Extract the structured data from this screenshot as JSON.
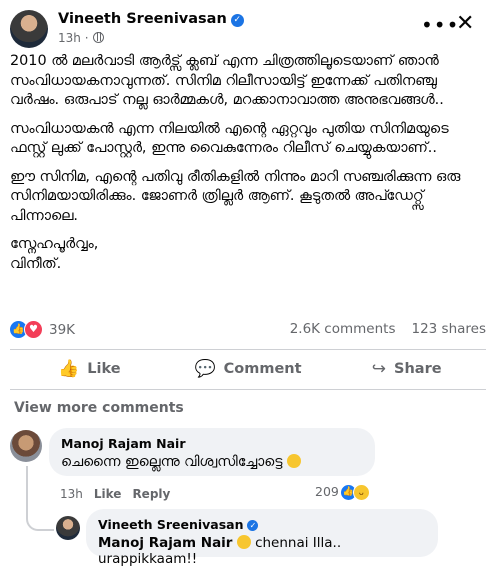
{
  "post": {
    "author": "Vineeth Sreenivasan",
    "time": "13h",
    "more_icon": "ellipsis-icon",
    "close_icon": "close-icon",
    "paragraphs": [
      "2010 ൽ മലർവാടി ആർട്സ് ക്ലബ് എന്ന ചിത്രത്തിലൂടെയാണ് ഞാൻ സംവിധായകനാവുന്നത്. സിനിമ റിലീസായിട്ട് ഇന്നേക്ക് പതിനഞ്ചു വർഷം. ഒരുപാട് നല്ല ഓർമ്മകൾ, മറക്കാനാവാത്ത അനുഭവങ്ങൾ..",
      "സംവിധായകൻ എന്ന നിലയിൽ എന്റെ ഏറ്റവും പുതിയ സിനിമയുടെ ഫസ്റ്റ് ലുക്ക് പോസ്റ്റർ, ഇന്നു വൈകുന്നേരം റിലീസ് ചെയ്യുകയാണ്..",
      "ഈ സിനിമ, എന്റെ പതിവു രീതികളിൽ നിന്നും മാറി സഞ്ചരിക്കുന്ന ഒരു സിനിമയായിരിക്കും. ജോണർ ത്രില്ലർ ആണ്. കൂടുതൽ അപ്ഡേറ്റ്സ് പിന്നാലെ.",
      "സ്നേഹപൂർവ്വം,\nവിനീത്."
    ],
    "reactions_count": "39K",
    "comments_count": "2.6K comments",
    "shares_count": "123 shares"
  },
  "actions": {
    "like": "Like",
    "comment": "Comment",
    "share": "Share"
  },
  "comments": {
    "view_more": "View more comments",
    "items": [
      {
        "author": "Manoj Rajam Nair",
        "text": "ചെന്നൈ ഇല്ലെന്നു വിശ്വസിച്ചോട്ടെ",
        "time": "13h",
        "like_label": "Like",
        "reply_label": "Reply",
        "reaction_count": "209"
      },
      {
        "author": "Vineeth Sreenivasan",
        "mention": "Manoj Rajam Nair",
        "text": "chennai Illa.. urappikkaam!!"
      }
    ]
  },
  "colors": {
    "accent": "#1877f2",
    "love": "#f33e58",
    "muted": "#65676b",
    "bubble": "#f0f2f5"
  }
}
